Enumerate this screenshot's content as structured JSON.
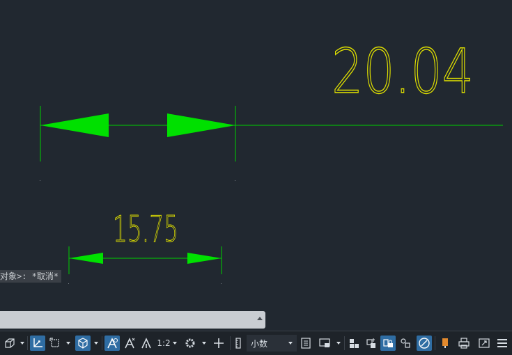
{
  "drawing": {
    "dimension_large": "20.04",
    "dimension_small": "15.75",
    "colors": {
      "background": "#212830",
      "dimension_line": "#00d000",
      "dimension_text": "#e0e000"
    }
  },
  "command_line": {
    "history_text": "对象>: *取消*",
    "input_value": ""
  },
  "status_bar": {
    "annotation_scale": "1:2",
    "units": "小数",
    "icons": [
      "isolate-objects-icon",
      "snap-tracking-icon",
      "selection-cycling-icon",
      "3d-osnap-icon",
      "annotation-visibility-icon",
      "auto-scale-icon",
      "annotation-scale-icon",
      "workspace-gear-icon",
      "crosshair-icon",
      "units-ruler-icon",
      "quick-properties-icon",
      "graphics-performance-icon",
      "isolate-icon",
      "hardware-accel-icon",
      "lock-ui-icon",
      "clean-screen-icon",
      "customization-icon",
      "plot-icon",
      "fullscreen-icon",
      "menu-icon"
    ]
  }
}
